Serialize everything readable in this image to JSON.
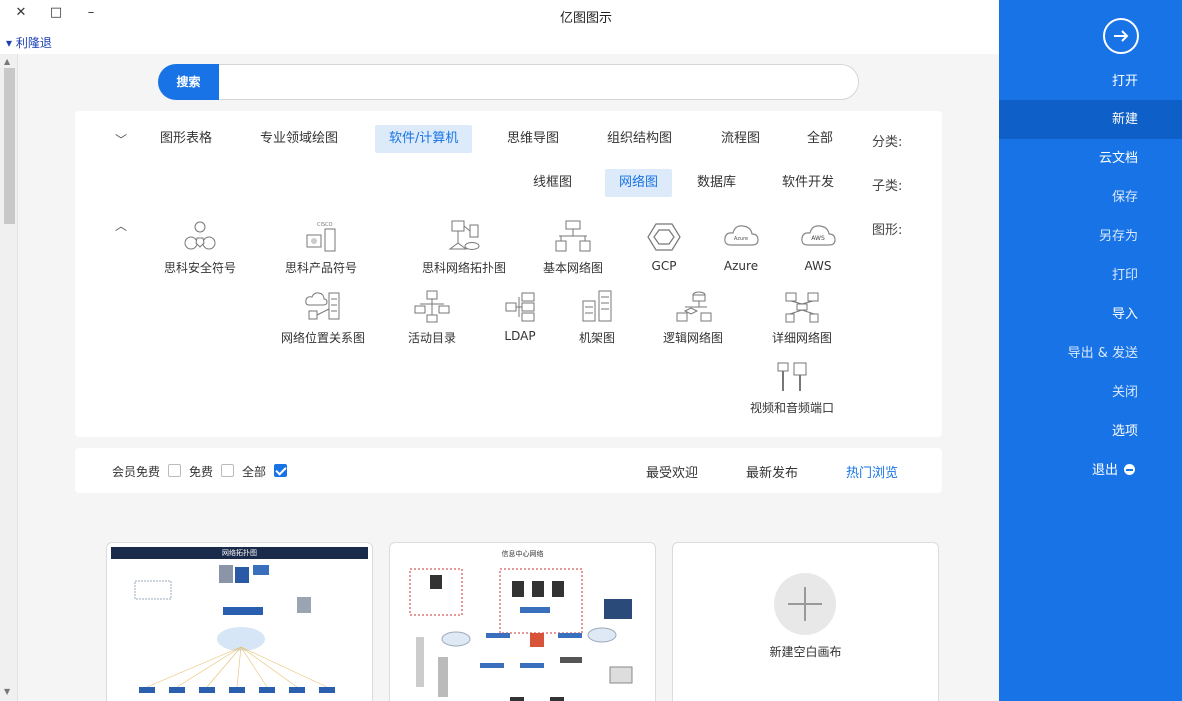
{
  "window": {
    "title": "亿图图示",
    "minimize": "–",
    "maximize": "□",
    "close": "✕"
  },
  "menubar": {
    "label": "▾ 利隆退"
  },
  "search": {
    "button": "搜索",
    "value": "",
    "placeholder": ""
  },
  "categories": {
    "row1_label": "分类:",
    "row1_items": [
      "全部",
      "流程图",
      "组织结构图",
      "思维导图",
      "软件/计算机",
      "专业领域绘图",
      "图形表格"
    ],
    "row2_label": "子类:",
    "row2_items": [
      "软件开发",
      "数据库",
      "网络图",
      "线框图"
    ],
    "row3_label": "图形:",
    "shapes_row1": [
      "AWS",
      "Azure",
      "GCP",
      "基本网络图",
      "思科网络拓扑图",
      "思科产品符号",
      "思科安全符号"
    ],
    "shapes_row2": [
      "详细网络图",
      "逻辑网络图",
      "机架图",
      "LDAP",
      "活动目录",
      "网络位置关系图"
    ],
    "shapes_row3": [
      "视频和音频端口"
    ],
    "icon_texts": {
      "aws": "AWS",
      "azure": "Azure",
      "cisco": "CISCO"
    }
  },
  "filters": {
    "tabs": [
      "热门浏览",
      "最新发布",
      "最受欢迎"
    ],
    "checks": [
      "全部",
      "免费",
      "会员免费"
    ]
  },
  "cards": {
    "card1_header": "网络拓扑图",
    "card2_caption": "信息中心网络",
    "new_blank": "新建空白画布"
  },
  "sidebar": {
    "items": [
      "打开",
      "新建",
      "云文档",
      "保存",
      "另存为",
      "打印",
      "导入",
      "导出 & 发送",
      "关闭",
      "选项",
      "退出"
    ]
  },
  "colors": {
    "accent": "#1874e6",
    "accent_dark": "#0e5fc7",
    "chip_bg": "#ddeaf9"
  }
}
